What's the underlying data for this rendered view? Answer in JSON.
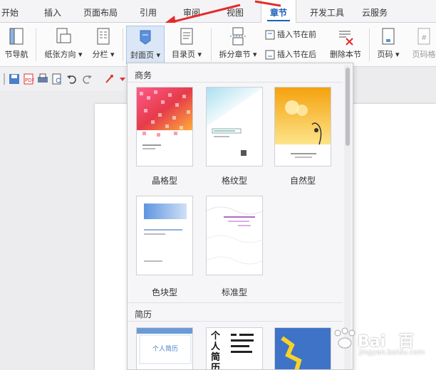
{
  "tabs": [
    {
      "label": "开始"
    },
    {
      "label": "插入"
    },
    {
      "label": "页面布局"
    },
    {
      "label": "引用"
    },
    {
      "label": "审阅"
    },
    {
      "label": "视图"
    },
    {
      "label": "章节"
    },
    {
      "label": "开发工具"
    },
    {
      "label": "云服务"
    }
  ],
  "active_tab": "章节",
  "ribbon": {
    "nav": "节导航",
    "orientation": "纸张方向",
    "columns": "分栏",
    "cover": "封面页",
    "toc": "目录页",
    "split": "拆分章节",
    "insert_before": "插入节在前",
    "insert_after": "插入节在后",
    "delete_section": "删除本节",
    "page_number": "页码",
    "page_format": "页码格"
  },
  "dropdown": {
    "section1": "商务",
    "templates1": [
      {
        "label": "晶格型",
        "color": "#e23a5e"
      },
      {
        "label": "格纹型",
        "color": "#9fd8ea"
      },
      {
        "label": "自然型",
        "color": "#f2b11c"
      },
      {
        "label": "色块型",
        "color": "#6aa3e0"
      },
      {
        "label": "标准型",
        "color": "#b06ac6"
      }
    ],
    "section2": "简历",
    "resume_texts": [
      "个人简历",
      "个人简历"
    ]
  },
  "watermark": {
    "brand": "Bai",
    "brand2": "百",
    "sub": "jingyan.baidu.com"
  }
}
